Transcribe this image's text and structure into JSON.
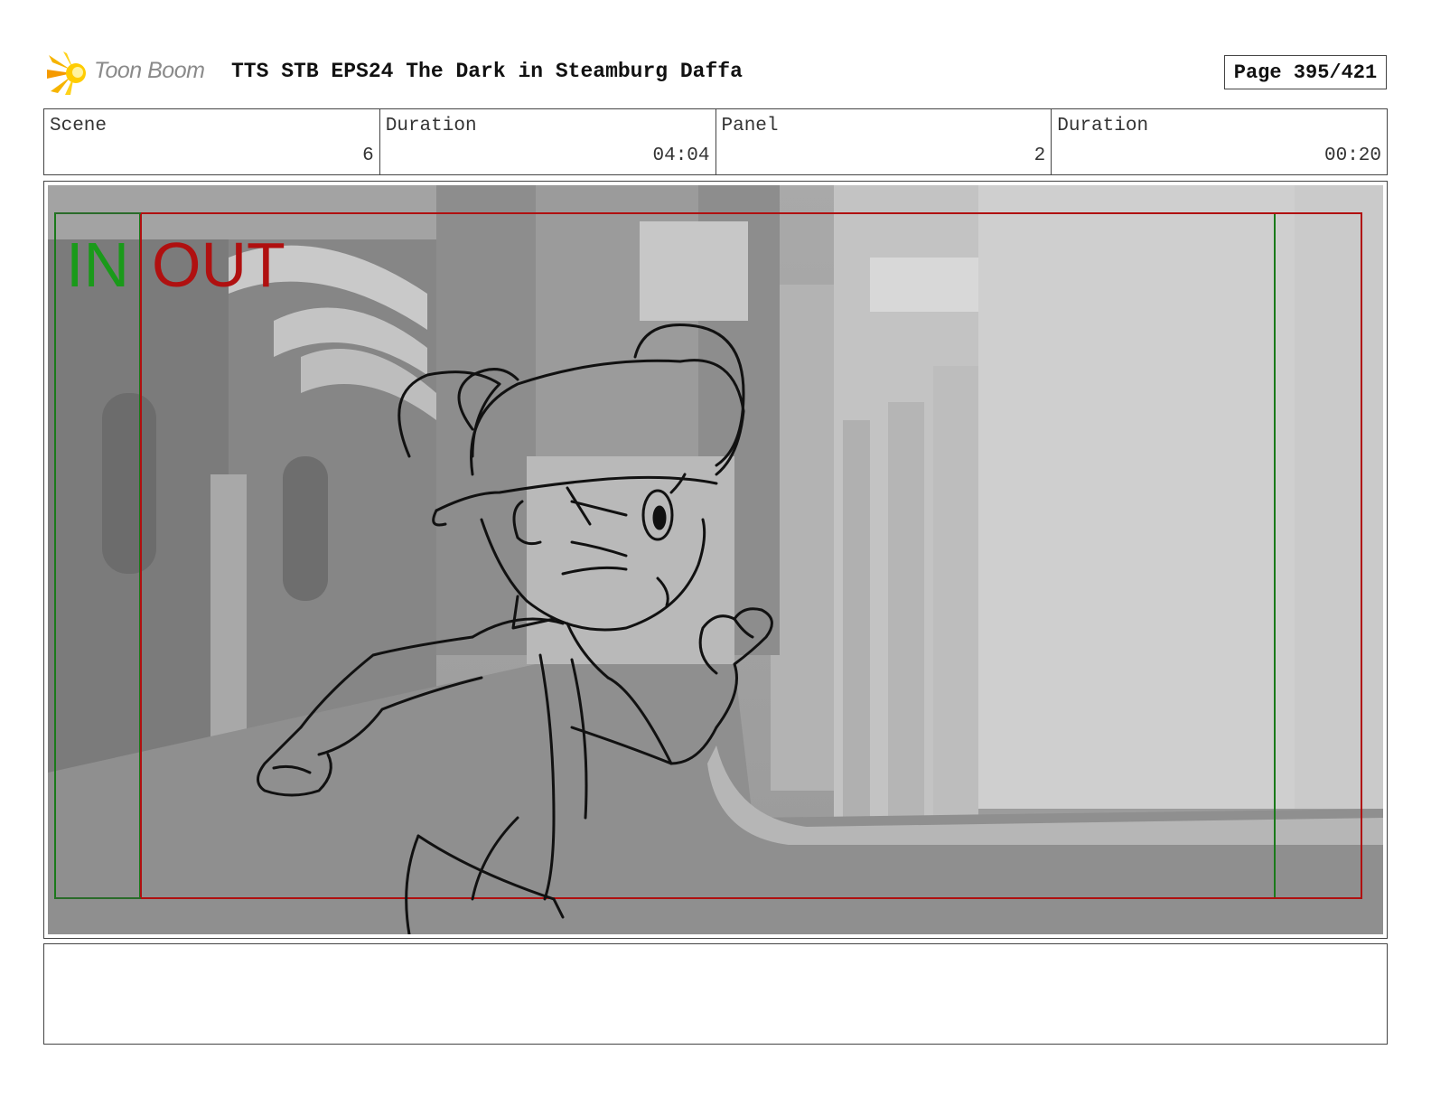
{
  "header": {
    "logo_text": "Toon Boom",
    "title": "TTS STB EPS24 The Dark in Steamburg Daffa",
    "page": "Page 395/421"
  },
  "info": {
    "scene_label": "Scene",
    "scene_value": "6",
    "scene_duration_label": "Duration",
    "scene_duration_value": "04:04",
    "panel_label": "Panel",
    "panel_value": "2",
    "panel_duration_label": "Duration",
    "panel_duration_value": "00:20"
  },
  "panel": {
    "in_label": "IN",
    "out_label": "OUT",
    "colors": {
      "in": "#1a9a1a",
      "out": "#b01010"
    }
  },
  "notes": {
    "text": ""
  }
}
